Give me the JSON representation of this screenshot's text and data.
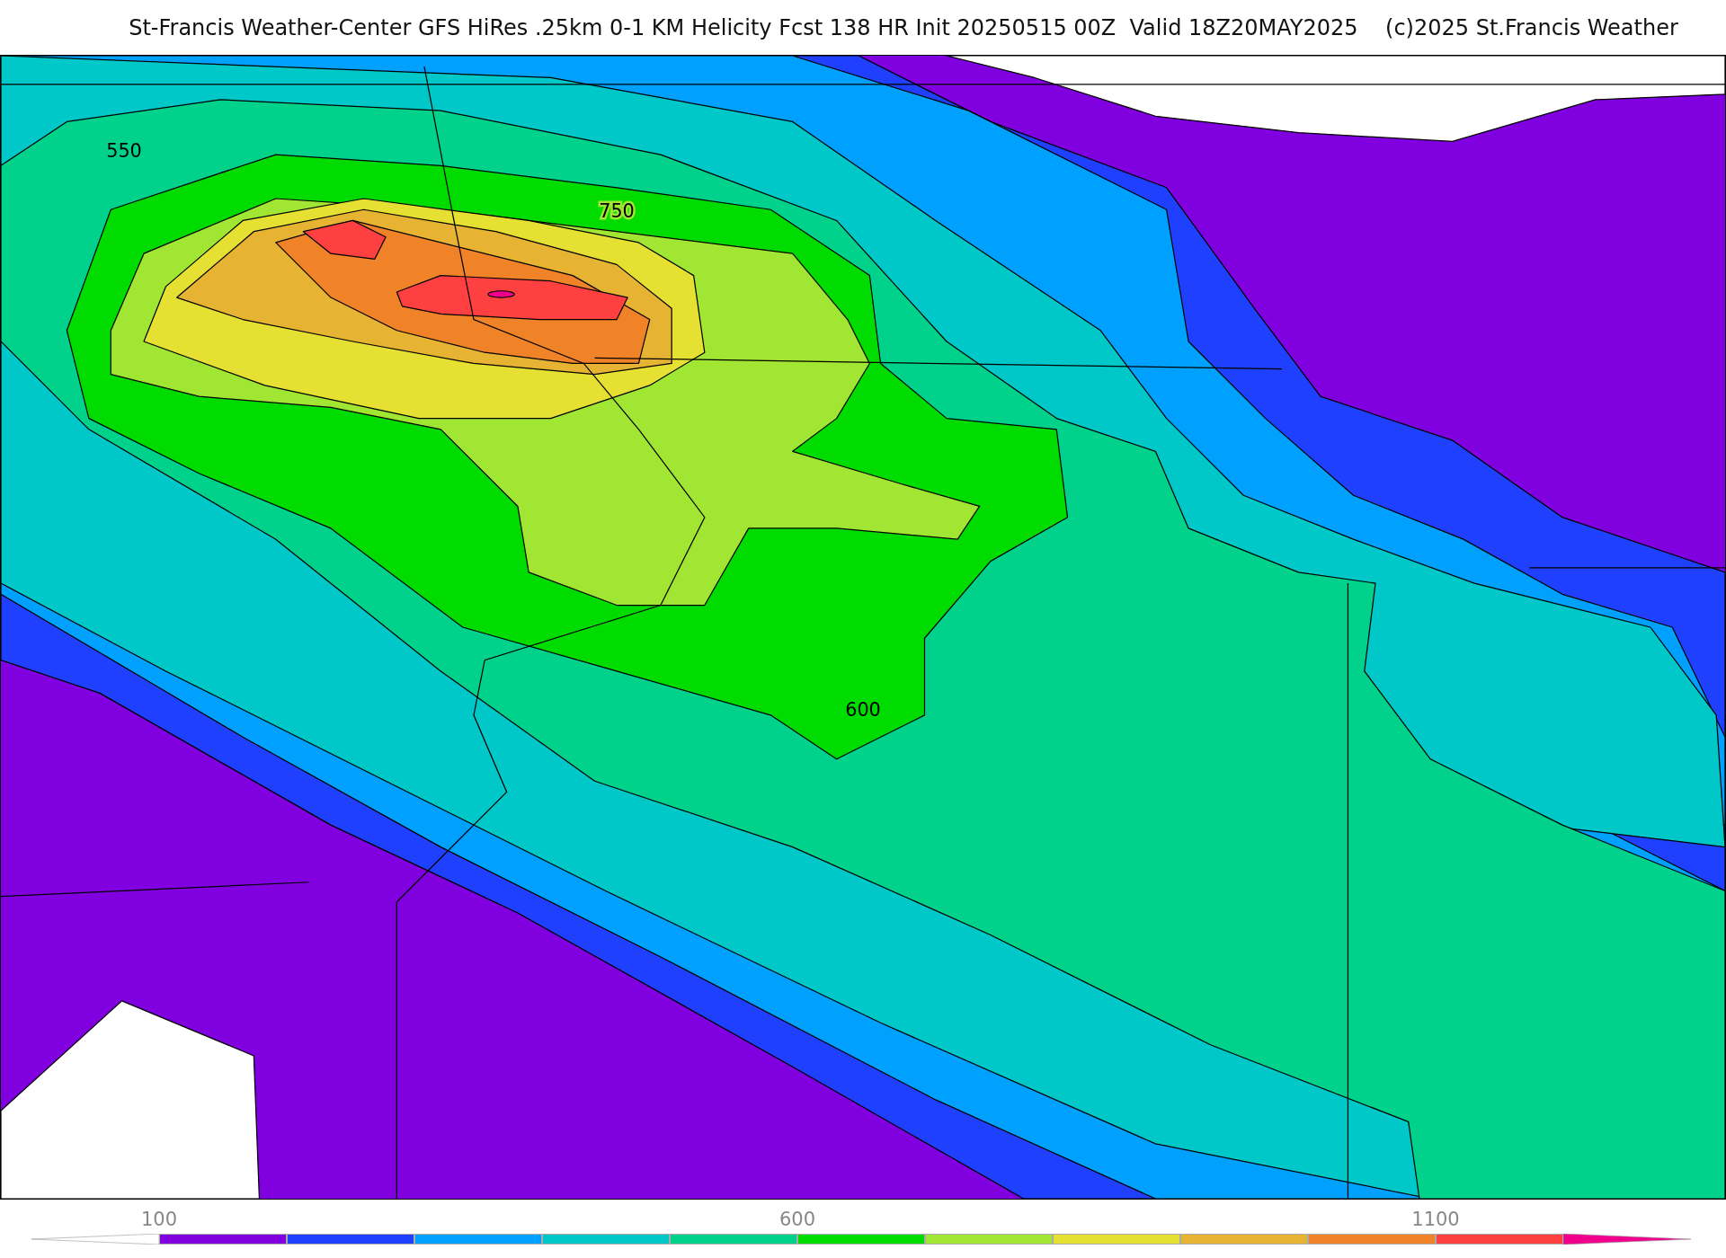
{
  "title": "St-Francis Weather-Center GFS HiRes .25km 0-1 KM Helicity Fcst 138 HR Init 20250515 00Z  Valid 18Z20MAY2025    (c)2025 St.Francis Weather",
  "contour_labels": [
    {
      "text": "550",
      "kind": "teal"
    },
    {
      "text": "750",
      "kind": "lightgreen"
    },
    {
      "text": "600",
      "kind": "green"
    }
  ],
  "colorbar": {
    "segments": [
      {
        "kind": "left-arrow"
      },
      {
        "kind": "box",
        "color": "#8000e0",
        "tick": "100"
      },
      {
        "kind": "box",
        "color": "#2040ff"
      },
      {
        "kind": "box",
        "color": "#00a0ff"
      },
      {
        "kind": "box",
        "color": "#00c8c8"
      },
      {
        "kind": "box",
        "color": "#00d28c"
      },
      {
        "kind": "box",
        "color": "#00dc00",
        "tick": "600"
      },
      {
        "kind": "box",
        "color": "#a0e632"
      },
      {
        "kind": "box",
        "color": "#e6e032"
      },
      {
        "kind": "box",
        "color": "#e6b432"
      },
      {
        "kind": "box",
        "color": "#f08228"
      },
      {
        "kind": "box",
        "color": "#ff4040",
        "tick": "1100"
      },
      {
        "kind": "right-arrow",
        "color": "#f0008c"
      }
    ]
  }
}
